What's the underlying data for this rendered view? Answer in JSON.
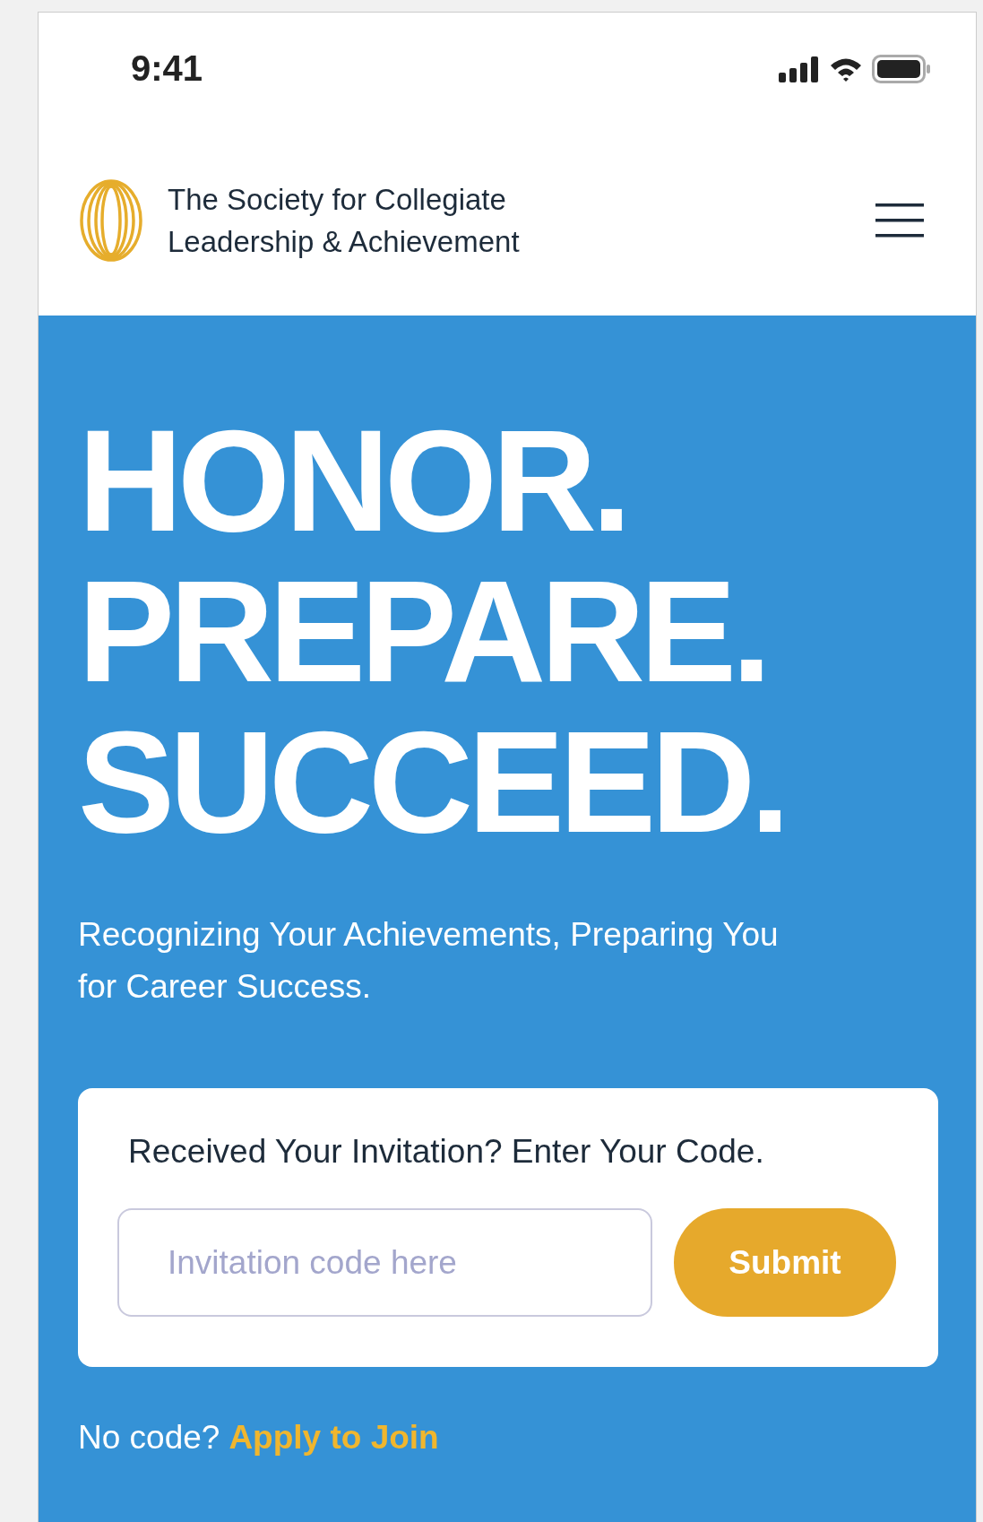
{
  "status_bar": {
    "time": "9:41"
  },
  "header": {
    "org_name_lines": [
      "The Society for Collegiate",
      "Leadership & Achievement"
    ]
  },
  "hero": {
    "headline_lines": [
      "HONOR.",
      "PREPARE.",
      "SUCCEED."
    ],
    "subtitle": "Recognizing Your Achievements, Preparing You for Career Success."
  },
  "invite_card": {
    "title": "Received Your Invitation? Enter Your Code.",
    "placeholder": "Invitation code here",
    "button": "Submit"
  },
  "footer": {
    "prompt": "No code?",
    "link": "Apply to Join"
  }
}
